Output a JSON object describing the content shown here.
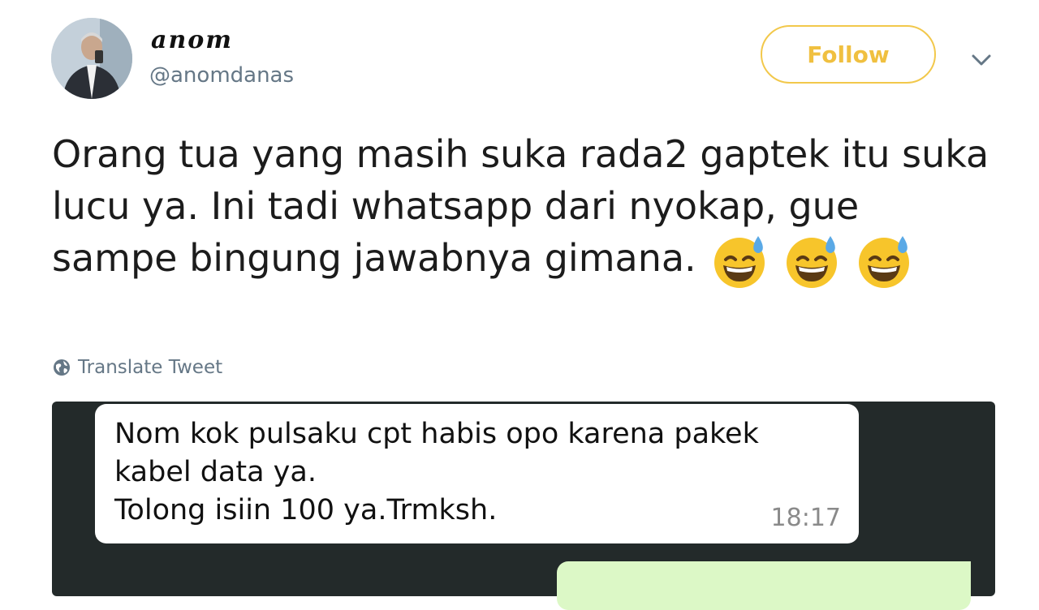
{
  "tweet": {
    "display_name": "anom",
    "handle": "@anomdanas",
    "follow_label": "Follow",
    "text": "Orang tua yang masih suka rada2 gaptek itu suka lucu ya. Ini tadi whatsapp dari nyokap, gue sampe bingung jawabnya gimana.",
    "emoji": [
      "grinning-face-with-sweat",
      "grinning-face-with-sweat",
      "grinning-face-with-sweat"
    ],
    "translate_label": "Translate Tweet"
  },
  "chat": {
    "incoming_message": "Nom kok pulsaku cpt habis opo karena pakek\nkabel data ya.\nTolong isiin 100 ya.Trmksh.",
    "incoming_time": "18:17"
  },
  "colors": {
    "follow_accent": "#f2c84b",
    "chat_background": "#232a2a",
    "outgoing_bubble": "#dcf8c6",
    "muted_text": "#657786"
  }
}
